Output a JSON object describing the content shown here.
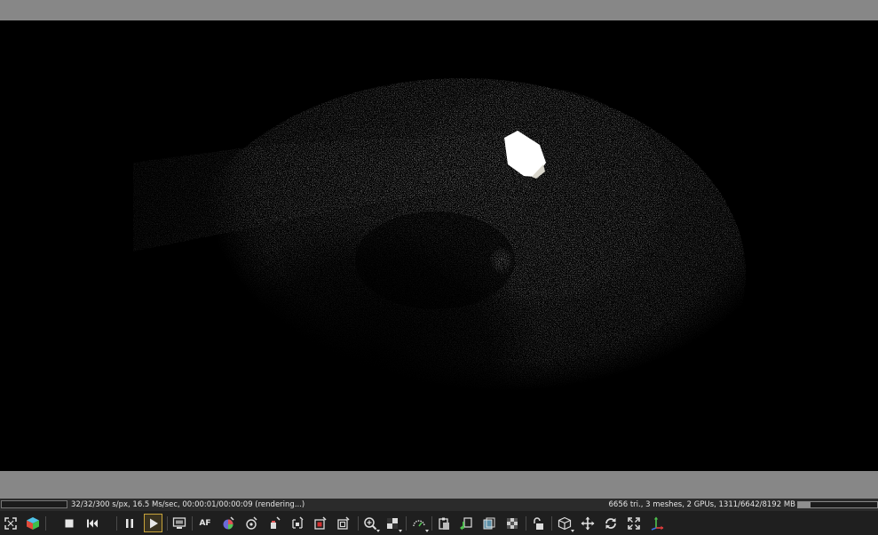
{
  "render_view": {
    "description_icon": "render-preview-image"
  },
  "status_bar": {
    "left_text": "32/32/300 s/px, 16.5 Ms/sec, 00:00:01/00:00:09 (rendering...)",
    "right_text": "6656 tri., 3 meshes, 2 GPUs, 1311/6642/8192 MB",
    "gpu_memory_fraction": 0.16
  },
  "toolbar": {
    "buttons": [
      {
        "name": "fit-view-icon"
      },
      {
        "name": "color-cube-icon"
      },
      {
        "name": "stop-icon"
      },
      {
        "name": "restart-icon"
      },
      {
        "name": "pause-icon"
      },
      {
        "name": "play-icon",
        "active": true
      },
      {
        "name": "region-render-icon"
      },
      {
        "name": "autofocus-icon",
        "label": "AF"
      },
      {
        "name": "material-picker-icon"
      },
      {
        "name": "camera-target-icon"
      },
      {
        "name": "white-balance-icon"
      },
      {
        "name": "focus-picker-icon"
      },
      {
        "name": "render-region-icon"
      },
      {
        "name": "film-region-icon"
      },
      {
        "name": "zoom-icon"
      },
      {
        "name": "checker-icon"
      },
      {
        "name": "gauge-icon"
      },
      {
        "name": "copy-clipboard-icon"
      },
      {
        "name": "export-icon"
      },
      {
        "name": "layers-icon"
      },
      {
        "name": "save-image-icon"
      },
      {
        "name": "lock-icon"
      },
      {
        "name": "box-view-icon"
      },
      {
        "name": "move-icon"
      },
      {
        "name": "rotate-icon"
      },
      {
        "name": "fullscreen-icon"
      },
      {
        "name": "axis-gizmo-icon"
      }
    ]
  },
  "colors": {
    "chrome_gray": "#878787",
    "toolbar_bg": "#1f1f1f",
    "active_outline": "#c7a33a"
  }
}
